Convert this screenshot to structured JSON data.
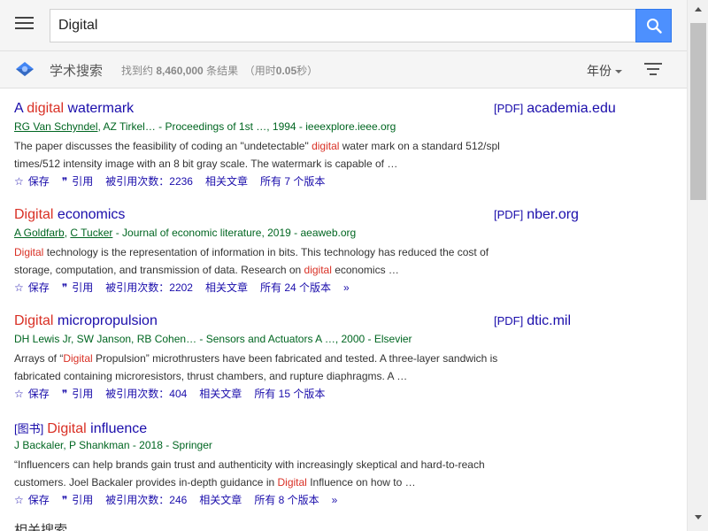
{
  "search": {
    "value": "Digital"
  },
  "subbar": {
    "brand": "学术搜索",
    "stats_prefix": "找到约 ",
    "stats_count": "8,460,000",
    "stats_suffix": " 条结果",
    "time_prefix": "（用时",
    "time_value": "0.05",
    "time_suffix": "秒）",
    "year_label": "年份"
  },
  "results": [
    {
      "title_pre": "A ",
      "title_hl": "digital",
      "title_post": " watermark",
      "side_tag": "[PDF]",
      "side_domain": "academia.edu",
      "author_links": [
        "RG Van Schyndel"
      ],
      "authors_rest": ", AZ Tirkel… - Proceedings of 1st …, 1994 - ieeexplore.ieee.org",
      "snippet_1": "The paper discusses the feasibility of coding an \"undetectable\" ",
      "snippet_hl": "digital",
      "snippet_2": " water mark on a standard 512/spl times/512 intensity image with an 8 bit gray scale. The watermark is capable of …",
      "save": "保存",
      "cite": "引用",
      "cited_by": "被引用次数：2236",
      "related": "相关文章",
      "versions": "所有 7 个版本"
    },
    {
      "title_hl": "Digital",
      "title_post": " economics",
      "side_tag": "[PDF]",
      "side_domain": "nber.org",
      "author_links": [
        "A Goldfarb",
        "C Tucker"
      ],
      "authors_rest": " - Journal of economic literature, 2019 - aeaweb.org",
      "snippet_hl0": "Digital",
      "snippet_1": " technology is the representation of information in bits. This technology has reduced the cost of storage, computation, and transmission of data. Research on ",
      "snippet_hl": "digital",
      "snippet_2": " economics …",
      "save": "保存",
      "cite": "引用",
      "cited_by": "被引用次数：2202",
      "related": "相关文章",
      "versions": "所有 24 个版本",
      "more": "»"
    },
    {
      "title_hl": "Digital",
      "title_post": " micropropulsion",
      "side_tag": "[PDF]",
      "side_domain": "dtic.mil",
      "authors_rest": "DH Lewis Jr, SW Janson, RB Cohen… - Sensors and Actuators A …, 2000 - Elsevier",
      "snippet_1": "Arrays of “",
      "snippet_hl": "Digital",
      "snippet_2": " Propulsion” microthrusters have been fabricated and tested. A three-layer sandwich is fabricated containing microresistors, thrust chambers, and rupture diaphragms. A …",
      "save": "保存",
      "cite": "引用",
      "cited_by": "被引用次数：404",
      "related": "相关文章",
      "versions": "所有 15 个版本"
    },
    {
      "type_tag": "[图书]",
      "title_hl": "Digital",
      "title_post": " influence",
      "authors_rest": "J Backaler, P Shankman - 2018 - Springer",
      "snippet_1": "“Influencers can help brands gain trust and authenticity with increasingly skeptical and hard-to-reach customers. Joel Backaler provides in-depth guidance in ",
      "snippet_hl": "Digital",
      "snippet_2": " Influence on how to …",
      "save": "保存",
      "cite": "引用",
      "cited_by": "被引用次数：246",
      "related": "相关文章",
      "versions": "所有 8 个版本",
      "more": "»"
    }
  ],
  "related_peek": "相关搜索",
  "colors": {
    "link": "#1a0dab",
    "highlight": "#d93025",
    "author_green": "#006621",
    "search_button": "#4d90fe"
  },
  "icons": [
    "menu-icon",
    "search-icon",
    "scholar-logo-icon",
    "sort-filter-icon",
    "star-icon",
    "quote-icon",
    "double-chevron-icon"
  ]
}
